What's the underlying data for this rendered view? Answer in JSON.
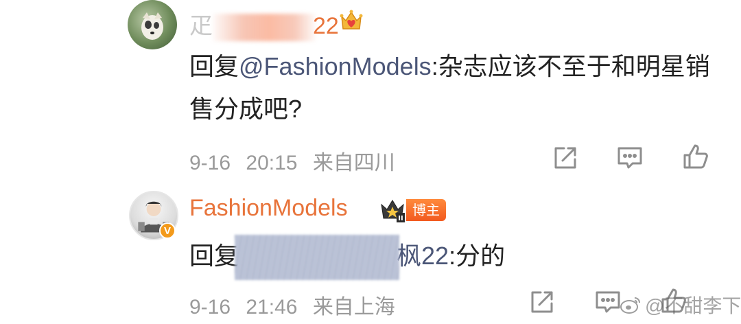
{
  "comments": [
    {
      "username_visible_suffix": "22",
      "username_faded_prefix": "疋",
      "reply_prefix": "回复",
      "mention": "@FashionModels",
      "text": ":杂志应该不至于和明星销售分成吧?",
      "date": "9-16",
      "time": "20:15",
      "location": "来自四川",
      "icons": {
        "crown": "crown-heart-badge-icon",
        "share": "share-icon",
        "comment": "comment-icon",
        "like": "thumbs-up-icon"
      }
    },
    {
      "username": "FashionModels",
      "badge": "博主",
      "reply_prefix": "回复",
      "mention_visible_suffix": "枫22",
      "text": ":分的",
      "date": "9-16",
      "time": "21:46",
      "location": "来自上海",
      "icons": {
        "verified": "verified-v-icon",
        "crown": "crown-level-ii-icon",
        "share": "share-icon",
        "comment": "comment-icon",
        "like": "thumbs-up-icon"
      }
    }
  ],
  "watermark": {
    "text": "@不甜李下",
    "icon": "weibo-logo-icon"
  },
  "colors": {
    "username": "#e8743b",
    "mention": "#4b5677",
    "meta": "#9a9a9a",
    "body": "#222222",
    "badge": "#f25a1f",
    "verified": "#f39a1b"
  }
}
